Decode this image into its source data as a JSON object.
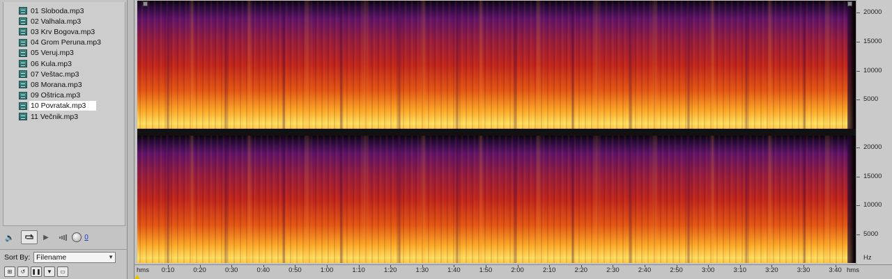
{
  "files": [
    {
      "name": "01 Sloboda.mp3",
      "selected": false
    },
    {
      "name": "02 Valhala.mp3",
      "selected": false
    },
    {
      "name": "03 Krv Bogova.mp3",
      "selected": false
    },
    {
      "name": "04 Grom Peruna.mp3",
      "selected": false
    },
    {
      "name": "05 Veruj.mp3",
      "selected": false
    },
    {
      "name": "06 Kula.mp3",
      "selected": false
    },
    {
      "name": "07 Veštac.mp3",
      "selected": false
    },
    {
      "name": "08 Morana.mp3",
      "selected": false
    },
    {
      "name": "09 Oštrica.mp3",
      "selected": false
    },
    {
      "name": "10 Povratak.mp3",
      "selected": true
    },
    {
      "name": "11 Večnik.mp3",
      "selected": false
    }
  ],
  "transport": {
    "volume_icon": "speaker-icon",
    "loop_icon": "loop-icon",
    "play_icon": "play-icon",
    "volume_value": "0"
  },
  "sort": {
    "label": "Sort By:",
    "value": "Filename",
    "buttons": [
      "add-icon",
      "refresh-icon",
      "pause-icon",
      "filter-icon",
      "clip-icon"
    ]
  },
  "spectrogram": {
    "channels": 2,
    "hz_unit": "Hz",
    "hz_labels": [
      "20000",
      "15000",
      "10000",
      "5000"
    ],
    "time_unit": "hms",
    "time_labels": [
      "0:10",
      "0:20",
      "0:30",
      "0:40",
      "0:50",
      "1:00",
      "1:10",
      "1:20",
      "1:30",
      "1:40",
      "1:50",
      "2:00",
      "2:10",
      "2:20",
      "2:30",
      "2:40",
      "2:50",
      "3:00",
      "3:10",
      "3:20",
      "3:30",
      "3:40"
    ],
    "colors": {
      "low": "#0a0406",
      "mid": "#d22a1e",
      "high": "#ffe060"
    }
  }
}
